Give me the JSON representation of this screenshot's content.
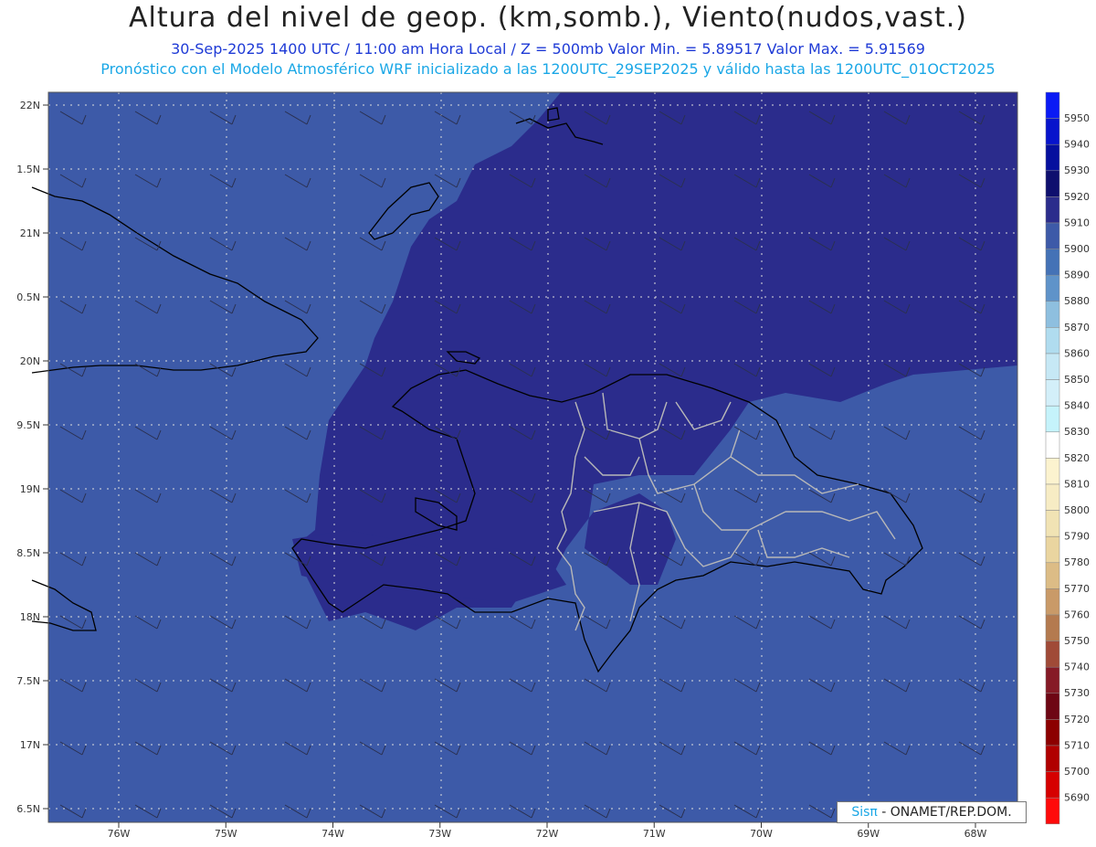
{
  "header": {
    "title": "Altura del nivel de geop. (km,somb.), Viento(nudos,vast.)",
    "subtitle1": "30-Sep-2025  1400 UTC / 11:00 am Hora Local / Z = 500mb    Valor Min. = 5.89517  Valor Max. = 5.91569",
    "subtitle2": "Pronóstico con el Modelo Atmosférico WRF inicializado a las 1200UTC_29SEP2025 y válido hasta las  1200UTC_01OCT2025"
  },
  "map": {
    "lat_labels": [
      "22N",
      "1.5N",
      "21N",
      "0.5N",
      "20N",
      "9.5N",
      "19N",
      "8.5N",
      "18N",
      "7.5N",
      "17N",
      "6.5N"
    ],
    "lon_labels": [
      "76W",
      "75W",
      "74W",
      "73W",
      "72W",
      "71W",
      "70W",
      "69W",
      "68W"
    ],
    "colors": {
      "shade_5900": "#3d5aa8",
      "shade_5910": "#2b2c8c",
      "coast": "#000000",
      "borders": "#b8b8b8",
      "grid": "#dddddd"
    }
  },
  "legend": {
    "levels": [
      {
        "label": "5950",
        "color": "#0a1af5"
      },
      {
        "label": "5940",
        "color": "#0714cc"
      },
      {
        "label": "5930",
        "color": "#050f9e"
      },
      {
        "label": "5920",
        "color": "#0e0f6e"
      },
      {
        "label": "5910",
        "color": "#2b2c8c"
      },
      {
        "label": "5900",
        "color": "#3d5aa8"
      },
      {
        "label": "5890",
        "color": "#4472b6"
      },
      {
        "label": "5880",
        "color": "#5f93c9"
      },
      {
        "label": "5870",
        "color": "#8ebfdf"
      },
      {
        "label": "5860",
        "color": "#b0dcef"
      },
      {
        "label": "5850",
        "color": "#c6e8f5"
      },
      {
        "label": "5840",
        "color": "#d3eff9"
      },
      {
        "label": "5830",
        "color": "#c5f3fb"
      },
      {
        "label": "5820",
        "color": "#ffffff"
      },
      {
        "label": "5810",
        "color": "#fcf3cf"
      },
      {
        "label": "5800",
        "color": "#f7ecc4"
      },
      {
        "label": "5790",
        "color": "#f1e3b4"
      },
      {
        "label": "5780",
        "color": "#ead5a0"
      },
      {
        "label": "5770",
        "color": "#dcbc86"
      },
      {
        "label": "5760",
        "color": "#c99a68"
      },
      {
        "label": "5750",
        "color": "#b47a4f"
      },
      {
        "label": "5740",
        "color": "#a04a37"
      },
      {
        "label": "5730",
        "color": "#861a26"
      },
      {
        "label": "5720",
        "color": "#6e0614"
      },
      {
        "label": "5710",
        "color": "#8c0000"
      },
      {
        "label": "5700",
        "color": "#b00000"
      },
      {
        "label": "5690",
        "color": "#d60000"
      },
      {
        "label": "",
        "color": "#ff0a0a"
      }
    ]
  },
  "credit": {
    "brand": "Sisπ",
    "text": "- ONAMET/REP.DOM."
  }
}
